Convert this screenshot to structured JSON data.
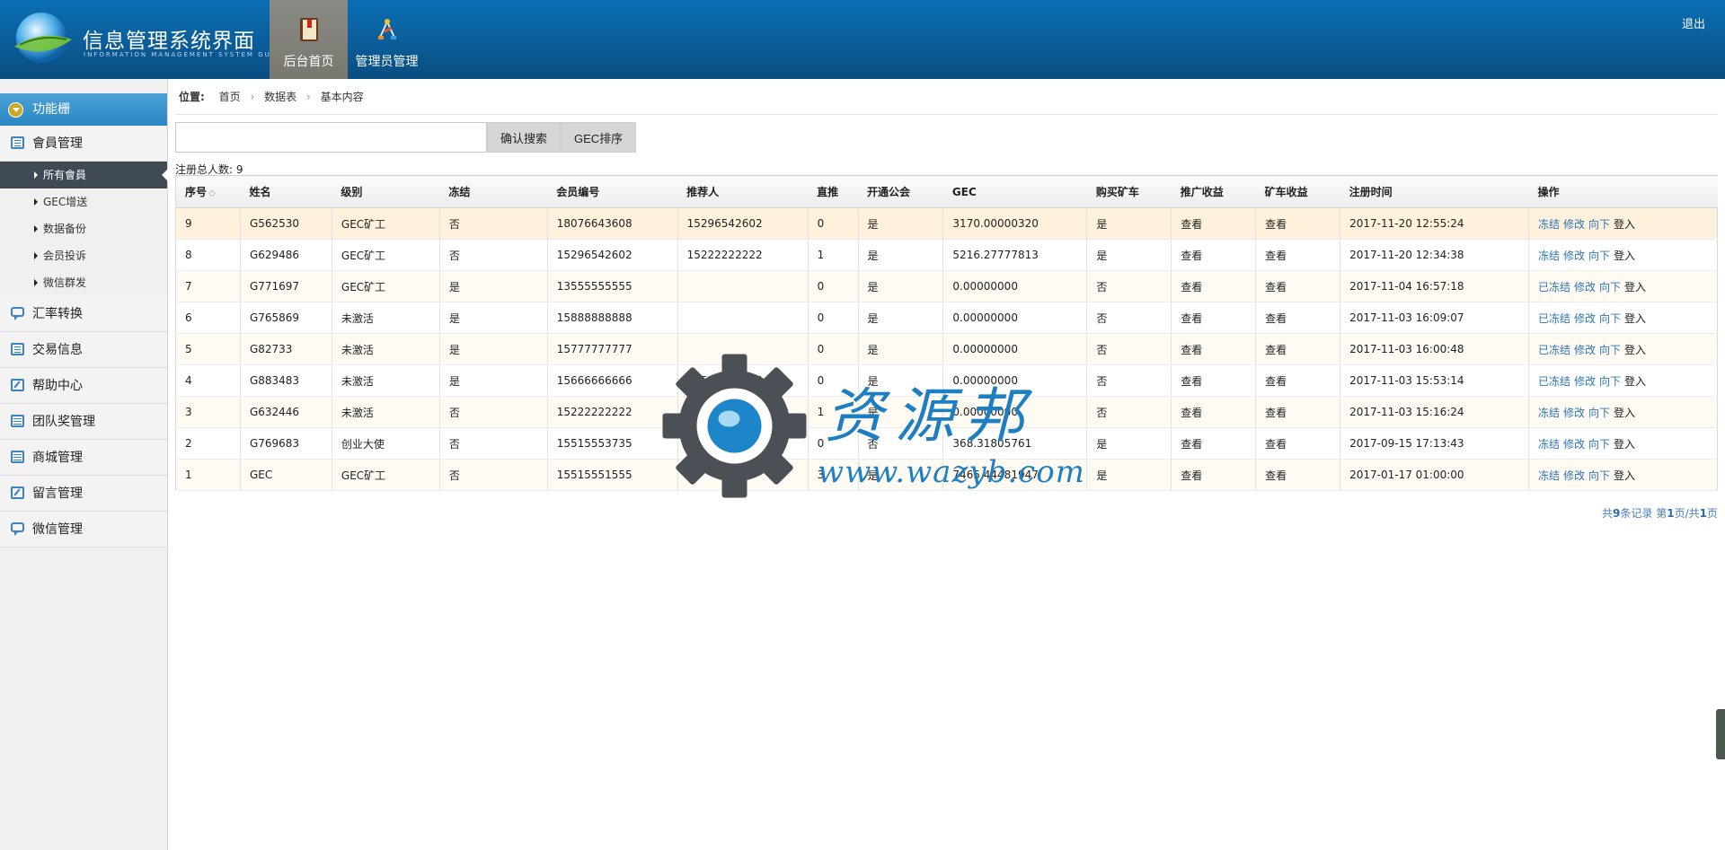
{
  "header": {
    "title": "信息管理系统界面",
    "subtitle": "INFORMATION MANAGEMENT SYSTEM GUI",
    "nav": [
      {
        "label": "后台首页",
        "icon": "book-icon"
      },
      {
        "label": "管理员管理",
        "icon": "tools-icon"
      }
    ],
    "logout": "退出"
  },
  "sidebar": {
    "head": "功能栅",
    "groups": [
      {
        "label": "會員管理",
        "icon": "list-icon"
      },
      {
        "label": "汇率转换",
        "icon": "chat-icon"
      },
      {
        "label": "交易信息",
        "icon": "list-icon"
      },
      {
        "label": "帮助中心",
        "icon": "edit-icon"
      },
      {
        "label": "团队奖管理",
        "icon": "calendar-icon"
      },
      {
        "label": "商城管理",
        "icon": "calendar-icon"
      },
      {
        "label": "留言管理",
        "icon": "edit-icon"
      },
      {
        "label": "微信管理",
        "icon": "chat-icon"
      }
    ],
    "subitems": [
      "所有會員",
      "GEC增送",
      "数据备份",
      "会员投诉",
      "微信群发"
    ]
  },
  "breadcrumb": {
    "label": "位置:",
    "items": [
      "首页",
      "数据表",
      "基本内容"
    ]
  },
  "toolbar": {
    "search_value": "",
    "search_button": "确认搜索",
    "sort_button": "GEC排序"
  },
  "total": "注册总人数: 9",
  "table": {
    "headers": [
      "序号",
      "姓名",
      "级别",
      "冻结",
      "会员编号",
      "推荐人",
      "直推",
      "开通公会",
      "GEC",
      "购买矿车",
      "推广收益",
      "矿车收益",
      "注册时间",
      "操作"
    ],
    "rows": [
      {
        "id": "9",
        "name": "G562530",
        "level": "GEC矿工",
        "frozen": "否",
        "member_no": "18076643608",
        "referrer": "15296542602",
        "direct": "0",
        "guild": "是",
        "gec": "3170.00000320",
        "buy": "是",
        "promo": "查看",
        "mine": "查看",
        "time": "2017-11-20 12:55:24",
        "op1": "冻结",
        "op2": "修改",
        "op3": "向下",
        "op4": "登入"
      },
      {
        "id": "8",
        "name": "G629486",
        "level": "GEC矿工",
        "frozen": "否",
        "member_no": "15296542602",
        "referrer": "15222222222",
        "direct": "1",
        "guild": "是",
        "gec": "5216.27777813",
        "buy": "是",
        "promo": "查看",
        "mine": "查看",
        "time": "2017-11-20 12:34:38",
        "op1": "冻结",
        "op2": "修改",
        "op3": "向下",
        "op4": "登入"
      },
      {
        "id": "7",
        "name": "G771697",
        "level": "GEC矿工",
        "frozen": "是",
        "member_no": "13555555555",
        "referrer": "",
        "direct": "0",
        "guild": "是",
        "gec": "0.00000000",
        "buy": "否",
        "promo": "查看",
        "mine": "查看",
        "time": "2017-11-04 16:57:18",
        "op1": "已冻结",
        "op2": "修改",
        "op3": "向下",
        "op4": "登入"
      },
      {
        "id": "6",
        "name": "G765869",
        "level": "未激活",
        "frozen": "是",
        "member_no": "15888888888",
        "referrer": "",
        "direct": "0",
        "guild": "是",
        "gec": "0.00000000",
        "buy": "否",
        "promo": "查看",
        "mine": "查看",
        "time": "2017-11-03 16:09:07",
        "op1": "已冻结",
        "op2": "修改",
        "op3": "向下",
        "op4": "登入"
      },
      {
        "id": "5",
        "name": "G82733",
        "level": "未激活",
        "frozen": "是",
        "member_no": "15777777777",
        "referrer": "",
        "direct": "0",
        "guild": "是",
        "gec": "0.00000000",
        "buy": "否",
        "promo": "查看",
        "mine": "查看",
        "time": "2017-11-03 16:00:48",
        "op1": "已冻结",
        "op2": "修改",
        "op3": "向下",
        "op4": "登入"
      },
      {
        "id": "4",
        "name": "G883483",
        "level": "未激活",
        "frozen": "是",
        "member_no": "15666666666",
        "referrer": "15515551555",
        "direct": "0",
        "guild": "是",
        "gec": "0.00000000",
        "buy": "否",
        "promo": "查看",
        "mine": "查看",
        "time": "2017-11-03 15:53:14",
        "op1": "已冻结",
        "op2": "修改",
        "op3": "向下",
        "op4": "登入"
      },
      {
        "id": "3",
        "name": "G632446",
        "level": "未激活",
        "frozen": "否",
        "member_no": "15222222222",
        "referrer": "15515553735",
        "direct": "1",
        "guild": "是",
        "gec": "0.00000000",
        "buy": "否",
        "promo": "查看",
        "mine": "查看",
        "time": "2017-11-03 15:16:24",
        "op1": "冻结",
        "op2": "修改",
        "op3": "向下",
        "op4": "登入"
      },
      {
        "id": "2",
        "name": "G769683",
        "level": "创业大使",
        "frozen": "否",
        "member_no": "15515553735",
        "referrer": "15515551555",
        "direct": "0",
        "guild": "否",
        "gec": "368.31805761",
        "buy": "是",
        "promo": "查看",
        "mine": "查看",
        "time": "2017-09-15 17:13:43",
        "op1": "冻结",
        "op2": "修改",
        "op3": "向下",
        "op4": "登入"
      },
      {
        "id": "1",
        "name": "GEC",
        "level": "GEC矿工",
        "frozen": "否",
        "member_no": "15515551555",
        "referrer": "",
        "direct": "3",
        "guild": "是",
        "gec": "7465.44481947",
        "buy": "是",
        "promo": "查看",
        "mine": "查看",
        "time": "2017-01-17 01:00:00",
        "op1": "冻结",
        "op2": "修改",
        "op3": "向下",
        "op4": "登入"
      }
    ]
  },
  "pager": {
    "prefix": "共",
    "count": "9",
    "mid": "条记录 第",
    "page": "1",
    "sep": "页/共",
    "pages": "1",
    "suffix": "页"
  },
  "watermark": {
    "text": "资源邦",
    "url": "www.wazyb.com"
  },
  "colors": {
    "header": "#0b5d99",
    "link": "#2b74b6",
    "danger": "#e01e1e",
    "active_nav": "#3f4a55"
  }
}
